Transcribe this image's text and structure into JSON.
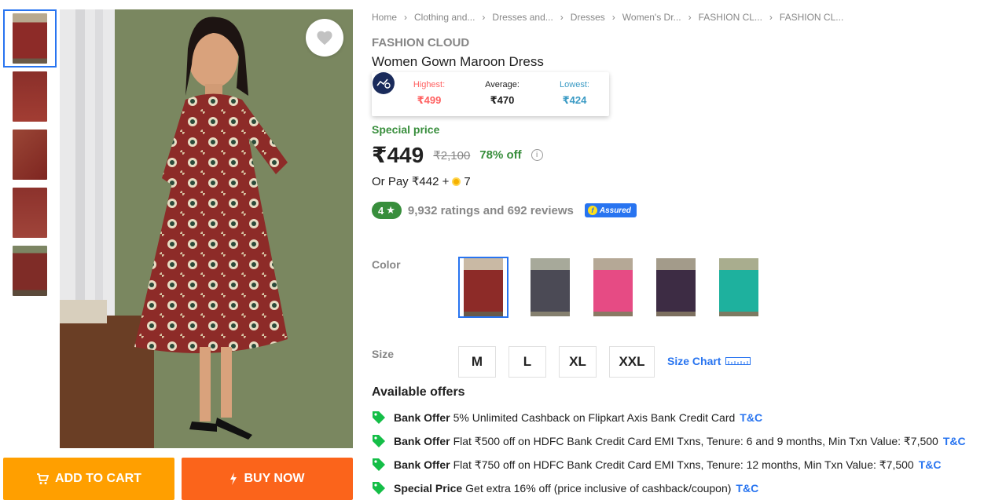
{
  "gallery": {
    "thumbnails": [
      {
        "color": "#8d2b28",
        "active": true
      },
      {
        "color": "#8a2f2a",
        "active": false
      },
      {
        "color": "#943a33",
        "active": false
      },
      {
        "color": "#8c322c",
        "active": false
      },
      {
        "color": "#7f2c27",
        "active": false
      }
    ],
    "main_image_color": "#8d2b28"
  },
  "actions": {
    "add_to_cart": "ADD TO CART",
    "buy_now": "BUY NOW"
  },
  "breadcrumb": [
    "Home",
    "Clothing and...",
    "Dresses and...",
    "Dresses",
    "Women's Dr...",
    "FASHION CL...",
    "FASHION CL..."
  ],
  "product": {
    "brand": "FASHION CLOUD",
    "title": "Women Gown Maroon Dress"
  },
  "price_history": {
    "highest_label": "Highest:",
    "highest_value": "₹499",
    "average_label": "Average:",
    "average_value": "₹470",
    "lowest_label": "Lowest:",
    "lowest_value": "₹424",
    "colors": {
      "highest": "#ff6161",
      "average": "#212121",
      "lowest": "#3a9ac4"
    }
  },
  "pricing": {
    "special_label": "Special price",
    "price": "₹449",
    "mrp": "₹2,100",
    "discount": "78% off",
    "or_pay_text": "Or Pay ₹442 +",
    "coins": "7"
  },
  "rating": {
    "score": "4",
    "summary": "9,932 ratings and 692 reviews",
    "assured_label": "Assured"
  },
  "color_section": {
    "label": "Color",
    "options": [
      {
        "name": "maroon",
        "swatch": "#8d2b28",
        "bg": "#c9b9a4",
        "active": true
      },
      {
        "name": "grey",
        "swatch": "#4b4a55",
        "bg": "#a7a99a",
        "active": false
      },
      {
        "name": "pink",
        "swatch": "#e64b84",
        "bg": "#b5a896",
        "active": false
      },
      {
        "name": "purple",
        "swatch": "#3d2c44",
        "bg": "#a39b8a",
        "active": false
      },
      {
        "name": "teal",
        "swatch": "#1eb19e",
        "bg": "#a9ad8e",
        "active": false
      }
    ]
  },
  "size_section": {
    "label": "Size",
    "sizes": [
      "M",
      "L",
      "XL",
      "XXL"
    ],
    "size_chart_label": "Size Chart"
  },
  "offers": {
    "title": "Available offers",
    "items": [
      {
        "type": "Bank Offer",
        "text": "5% Unlimited Cashback on Flipkart Axis Bank Credit Card",
        "link": "T&C"
      },
      {
        "type": "Bank Offer",
        "text": "Flat ₹500 off on HDFC Bank Credit Card EMI Txns, Tenure: 6 and 9 months, Min Txn Value: ₹7,500",
        "link": "T&C"
      },
      {
        "type": "Bank Offer",
        "text": "Flat ₹750 off on HDFC Bank Credit Card EMI Txns, Tenure: 12 months, Min Txn Value: ₹7,500",
        "link": "T&C"
      },
      {
        "type": "Special Price",
        "text": "Get extra 16% off (price inclusive of cashback/coupon)",
        "link": "T&C"
      }
    ],
    "tag_color": "#14be47"
  }
}
